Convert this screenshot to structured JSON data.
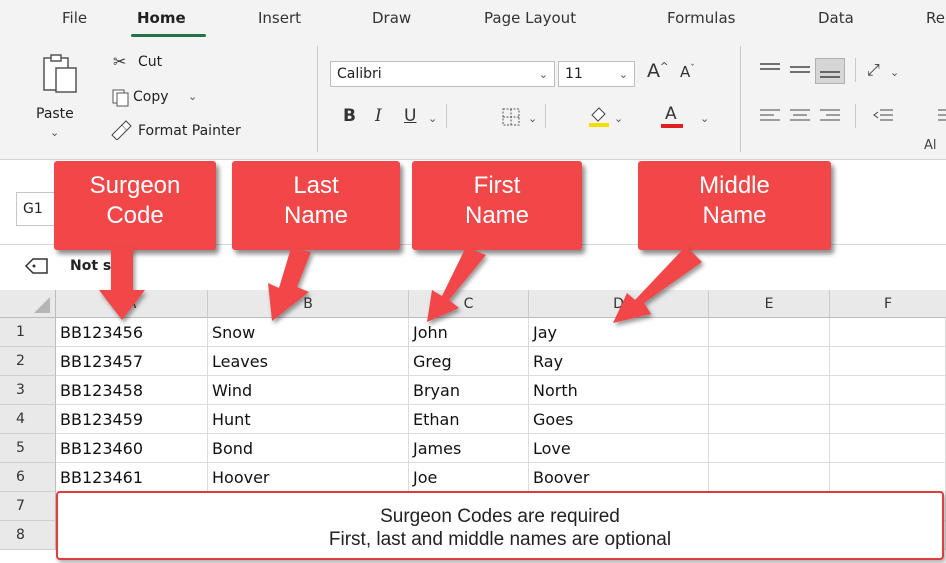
{
  "ribbon": {
    "tabs": [
      "File",
      "Home",
      "Insert",
      "Draw",
      "Page Layout",
      "Formulas",
      "Data",
      "Re"
    ],
    "active_tab": "Home",
    "accent_color": "#217346",
    "clipboard": {
      "paste_label": "Paste",
      "cut_label": "Cut",
      "copy_label": "Copy",
      "format_painter_label": "Format Painter"
    },
    "font": {
      "font_name": "Calibri",
      "font_size": "11",
      "bold_label": "B",
      "italic_label": "I",
      "underline_label": "U"
    },
    "alignment_group_partial_label": "Al"
  },
  "name_box": {
    "value": "G1"
  },
  "sensitivity": {
    "label": "Not set"
  },
  "grid": {
    "columns": [
      "A",
      "B",
      "C",
      "D",
      "E",
      "F"
    ],
    "row_numbers": [
      "1",
      "2",
      "3",
      "4",
      "5",
      "6",
      "7",
      "8"
    ],
    "rows": [
      [
        "BB123456",
        "Snow",
        "John",
        "Jay",
        "",
        ""
      ],
      [
        "BB123457",
        "Leaves",
        "Greg",
        "Ray",
        "",
        ""
      ],
      [
        "BB123458",
        "Wind",
        "Bryan",
        "North",
        "",
        ""
      ],
      [
        "BB123459",
        "Hunt",
        "Ethan",
        "Goes",
        "",
        ""
      ],
      [
        "BB123460",
        "Bond",
        "James",
        "Love",
        "",
        ""
      ],
      [
        "BB123461",
        "Hoover",
        "Joe",
        "Boover",
        "",
        ""
      ]
    ]
  },
  "callouts": {
    "color": "#f24748",
    "surgeon_code": [
      "Surgeon",
      "Code"
    ],
    "last_name": [
      "Last",
      "Name"
    ],
    "first_name": [
      "First",
      "Name"
    ],
    "middle_name": [
      "Middle",
      "Name"
    ]
  },
  "note": {
    "line1": "Surgeon Codes are required",
    "line2": "First, last and middle names are optional"
  }
}
